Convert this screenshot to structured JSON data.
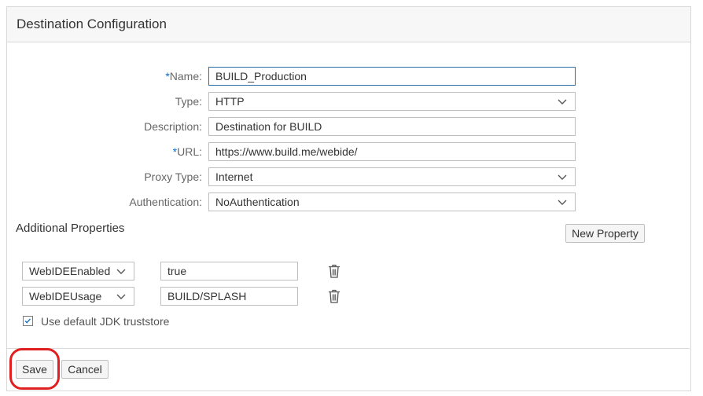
{
  "panel": {
    "title": "Destination Configuration"
  },
  "form": {
    "name": {
      "required_mark": "*",
      "label": "Name:",
      "value": "BUILD_Production"
    },
    "type": {
      "label": "Type:",
      "value": "HTTP"
    },
    "description": {
      "label": "Description:",
      "value": "Destination for BUILD"
    },
    "url": {
      "required_mark": "*",
      "label": "URL:",
      "value": "https://www.build.me/webide/"
    },
    "proxy_type": {
      "label": "Proxy Type:",
      "value": "Internet"
    },
    "authentication": {
      "label": "Authentication:",
      "value": "NoAuthentication"
    }
  },
  "additional_properties": {
    "title": "Additional Properties",
    "new_property_label": "New Property",
    "rows": [
      {
        "key": "WebIDEEnabled",
        "value": "true"
      },
      {
        "key": "WebIDEUsage",
        "value": "BUILD/SPLASH"
      }
    ],
    "use_default_jdk": {
      "label": "Use default JDK truststore",
      "checked": true
    }
  },
  "footer": {
    "save_label": "Save",
    "cancel_label": "Cancel"
  },
  "colors": {
    "accent": "#0a6ed1",
    "highlight": "#e02020"
  },
  "icons": {
    "dropdown": "chevron-down-icon",
    "delete": "trash-icon",
    "check": "check-icon"
  }
}
